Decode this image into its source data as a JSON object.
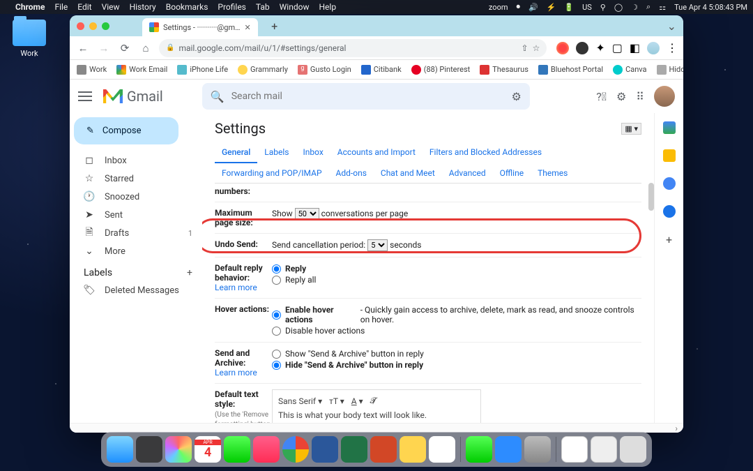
{
  "menubar": {
    "app": "Chrome",
    "items": [
      "File",
      "Edit",
      "View",
      "History",
      "Bookmarks",
      "Profiles",
      "Tab",
      "Window",
      "Help"
    ],
    "status": {
      "zoom": "zoom",
      "datetime": "Tue Apr 4  5:08:43 PM"
    }
  },
  "desktop": {
    "folder_label": "Work"
  },
  "browser": {
    "tab_title": "Settings - ··········@gm…",
    "url": "mail.google.com/mail/u/1/#settings/general",
    "bookmarks": [
      "Work",
      "Work Email",
      "iPhone Life",
      "Grammarly",
      "Gusto Login",
      "Citibank",
      "(88) Pinterest",
      "Thesaurus",
      "Bluehost Portal",
      "Canva",
      "Hidden Gems"
    ]
  },
  "gmail": {
    "logo": "Gmail",
    "search_placeholder": "Search mail",
    "compose": "Compose",
    "sidebar": [
      {
        "icon": "inbox",
        "label": "Inbox"
      },
      {
        "icon": "star",
        "label": "Starred"
      },
      {
        "icon": "clock",
        "label": "Snoozed"
      },
      {
        "icon": "send",
        "label": "Sent"
      },
      {
        "icon": "file",
        "label": "Drafts",
        "count": "1"
      },
      {
        "icon": "chev",
        "label": "More"
      }
    ],
    "labels_header": "Labels",
    "labels": [
      {
        "label": "Deleted Messages"
      }
    ],
    "settings_title": "Settings",
    "tabs_row1": [
      "General",
      "Labels",
      "Inbox",
      "Accounts and Import",
      "Filters and Blocked Addresses",
      "Forwarding and POP/IMAP",
      "Add-ons"
    ],
    "tabs_row2": [
      "Chat and Meet",
      "Advanced",
      "Offline",
      "Themes"
    ],
    "rows": {
      "numbers_label": "numbers:",
      "page_label": "Maximum page size:",
      "page_text_pre": "Show",
      "page_select": "50",
      "page_text_post": "conversations per page",
      "undo_label": "Undo Send:",
      "undo_pre": "Send cancellation period:",
      "undo_select": "5",
      "undo_post": "seconds",
      "reply_label": "Default reply behavior:",
      "reply_learn": "Learn more",
      "reply_opt1": "Reply",
      "reply_opt2": "Reply all",
      "hover_label": "Hover actions:",
      "hover_opt1": "Enable hover actions",
      "hover_desc": " - Quickly gain access to archive, delete, mark as read, and snooze controls on hover.",
      "hover_opt2": "Disable hover actions",
      "archive_label": "Send and Archive:",
      "archive_learn": "Learn more",
      "archive_opt1": "Show \"Send & Archive\" button in reply",
      "archive_opt2": "Hide \"Send & Archive\" button in reply",
      "textstyle_label": "Default text style:",
      "textstyle_note": "(Use the 'Remove formatting' button on the toolbar to reset the default",
      "font": "Sans Serif",
      "sample": "This is what your body text will look like."
    }
  }
}
